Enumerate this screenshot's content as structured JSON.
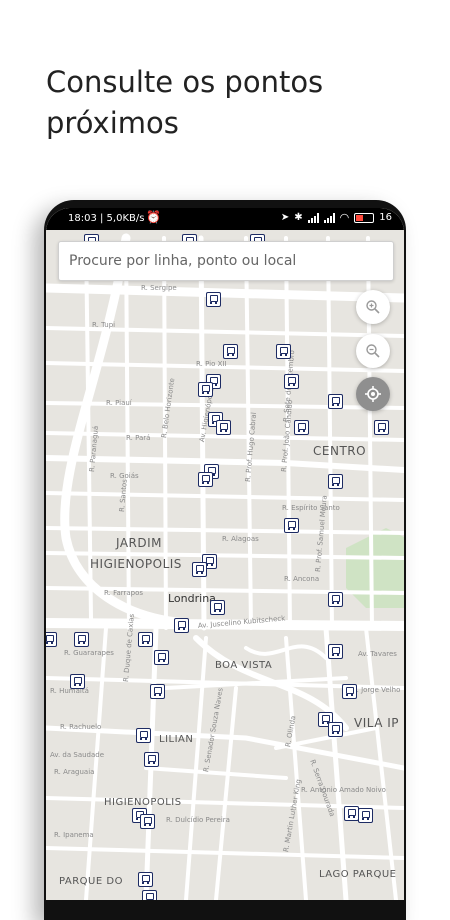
{
  "headline": "Consulte os pontos\npróximos",
  "status_bar": {
    "time": "18:03 | 5,0KB/s",
    "battery": "16"
  },
  "search": {
    "placeholder": "Procure por linha, ponto ou local"
  },
  "map": {
    "city_label": "Londrina",
    "area_labels": [
      "CENTRO",
      "JARDIM",
      "HIGIENOPOLIS",
      "BOA VISTA",
      "VILA IP",
      "LILIAN",
      "HIGIENOPOLIS",
      "PARQUE DO",
      "LAGO PARQUE"
    ],
    "street_labels": [
      "R. Sergipe",
      "R. Tupi",
      "R. Pio XII",
      "R. Piauí",
      "R. Pará",
      "R. Goiás",
      "Av. Higienópolis",
      "R. Belo Horizonte",
      "R. Paranaguá",
      "R. Santos",
      "R. Alagoas",
      "R. Espírito Santo",
      "R. Prof. Hugo Cabral",
      "R. Prof. João Cândido",
      "R. Farrapos",
      "R. Ancona",
      "Av. Juscelino Kubitscheck",
      "R. Guararapes",
      "R. Humaitá",
      "R. Rachuelo",
      "Av. da Saudade",
      "R. Ipanema",
      "R. Duque de Caxias",
      "R. Senador Souza Naves",
      "R. Jorge Velho",
      "R. Araguaia",
      "R. Olinda",
      "R. Serra Dourada",
      "R. Dulcídio Pereira",
      "R. Antônio Amado Noivo",
      "R. Martin Luther King",
      "Av. Tavares",
      "R. Prof. Samuel Moura",
      "R. Sete de Setembro"
    ],
    "stop_count": 52
  },
  "controls": {
    "zoom_in": "zoom-in",
    "zoom_out": "zoom-out",
    "locate": "my-location"
  },
  "colors": {
    "map_background": "#e7e5e0",
    "roads": "#ffffff",
    "stop_icon": "#1d2b63",
    "park": "#cfe3c4"
  }
}
